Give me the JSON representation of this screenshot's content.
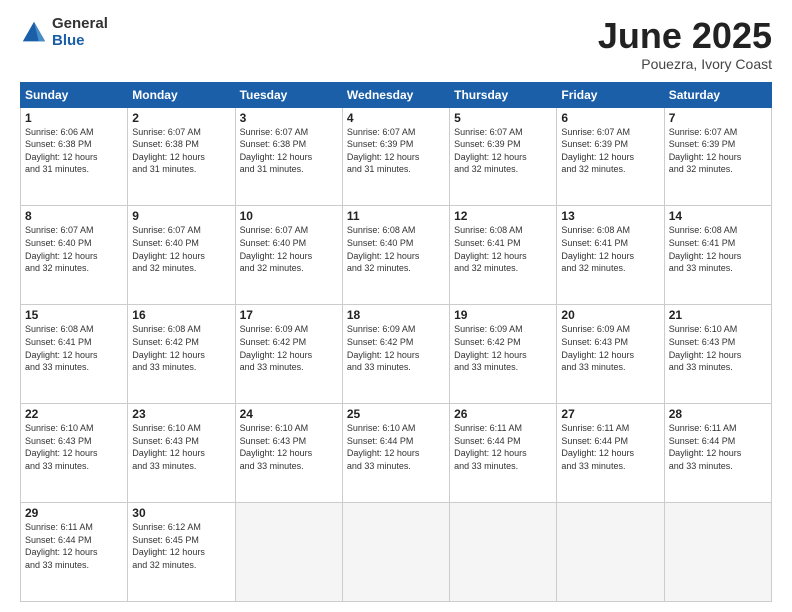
{
  "logo": {
    "general": "General",
    "blue": "Blue"
  },
  "title": {
    "month": "June 2025",
    "location": "Pouezra, Ivory Coast"
  },
  "weekdays": [
    "Sunday",
    "Monday",
    "Tuesday",
    "Wednesday",
    "Thursday",
    "Friday",
    "Saturday"
  ],
  "weeks": [
    [
      {
        "day": "1",
        "info": "Sunrise: 6:06 AM\nSunset: 6:38 PM\nDaylight: 12 hours\nand 31 minutes."
      },
      {
        "day": "2",
        "info": "Sunrise: 6:07 AM\nSunset: 6:38 PM\nDaylight: 12 hours\nand 31 minutes."
      },
      {
        "day": "3",
        "info": "Sunrise: 6:07 AM\nSunset: 6:38 PM\nDaylight: 12 hours\nand 31 minutes."
      },
      {
        "day": "4",
        "info": "Sunrise: 6:07 AM\nSunset: 6:39 PM\nDaylight: 12 hours\nand 31 minutes."
      },
      {
        "day": "5",
        "info": "Sunrise: 6:07 AM\nSunset: 6:39 PM\nDaylight: 12 hours\nand 32 minutes."
      },
      {
        "day": "6",
        "info": "Sunrise: 6:07 AM\nSunset: 6:39 PM\nDaylight: 12 hours\nand 32 minutes."
      },
      {
        "day": "7",
        "info": "Sunrise: 6:07 AM\nSunset: 6:39 PM\nDaylight: 12 hours\nand 32 minutes."
      }
    ],
    [
      {
        "day": "8",
        "info": "Sunrise: 6:07 AM\nSunset: 6:40 PM\nDaylight: 12 hours\nand 32 minutes."
      },
      {
        "day": "9",
        "info": "Sunrise: 6:07 AM\nSunset: 6:40 PM\nDaylight: 12 hours\nand 32 minutes."
      },
      {
        "day": "10",
        "info": "Sunrise: 6:07 AM\nSunset: 6:40 PM\nDaylight: 12 hours\nand 32 minutes."
      },
      {
        "day": "11",
        "info": "Sunrise: 6:08 AM\nSunset: 6:40 PM\nDaylight: 12 hours\nand 32 minutes."
      },
      {
        "day": "12",
        "info": "Sunrise: 6:08 AM\nSunset: 6:41 PM\nDaylight: 12 hours\nand 32 minutes."
      },
      {
        "day": "13",
        "info": "Sunrise: 6:08 AM\nSunset: 6:41 PM\nDaylight: 12 hours\nand 32 minutes."
      },
      {
        "day": "14",
        "info": "Sunrise: 6:08 AM\nSunset: 6:41 PM\nDaylight: 12 hours\nand 33 minutes."
      }
    ],
    [
      {
        "day": "15",
        "info": "Sunrise: 6:08 AM\nSunset: 6:41 PM\nDaylight: 12 hours\nand 33 minutes."
      },
      {
        "day": "16",
        "info": "Sunrise: 6:08 AM\nSunset: 6:42 PM\nDaylight: 12 hours\nand 33 minutes."
      },
      {
        "day": "17",
        "info": "Sunrise: 6:09 AM\nSunset: 6:42 PM\nDaylight: 12 hours\nand 33 minutes."
      },
      {
        "day": "18",
        "info": "Sunrise: 6:09 AM\nSunset: 6:42 PM\nDaylight: 12 hours\nand 33 minutes."
      },
      {
        "day": "19",
        "info": "Sunrise: 6:09 AM\nSunset: 6:42 PM\nDaylight: 12 hours\nand 33 minutes."
      },
      {
        "day": "20",
        "info": "Sunrise: 6:09 AM\nSunset: 6:43 PM\nDaylight: 12 hours\nand 33 minutes."
      },
      {
        "day": "21",
        "info": "Sunrise: 6:10 AM\nSunset: 6:43 PM\nDaylight: 12 hours\nand 33 minutes."
      }
    ],
    [
      {
        "day": "22",
        "info": "Sunrise: 6:10 AM\nSunset: 6:43 PM\nDaylight: 12 hours\nand 33 minutes."
      },
      {
        "day": "23",
        "info": "Sunrise: 6:10 AM\nSunset: 6:43 PM\nDaylight: 12 hours\nand 33 minutes."
      },
      {
        "day": "24",
        "info": "Sunrise: 6:10 AM\nSunset: 6:43 PM\nDaylight: 12 hours\nand 33 minutes."
      },
      {
        "day": "25",
        "info": "Sunrise: 6:10 AM\nSunset: 6:44 PM\nDaylight: 12 hours\nand 33 minutes."
      },
      {
        "day": "26",
        "info": "Sunrise: 6:11 AM\nSunset: 6:44 PM\nDaylight: 12 hours\nand 33 minutes."
      },
      {
        "day": "27",
        "info": "Sunrise: 6:11 AM\nSunset: 6:44 PM\nDaylight: 12 hours\nand 33 minutes."
      },
      {
        "day": "28",
        "info": "Sunrise: 6:11 AM\nSunset: 6:44 PM\nDaylight: 12 hours\nand 33 minutes."
      }
    ],
    [
      {
        "day": "29",
        "info": "Sunrise: 6:11 AM\nSunset: 6:44 PM\nDaylight: 12 hours\nand 33 minutes."
      },
      {
        "day": "30",
        "info": "Sunrise: 6:12 AM\nSunset: 6:45 PM\nDaylight: 12 hours\nand 32 minutes."
      },
      {
        "day": "",
        "info": ""
      },
      {
        "day": "",
        "info": ""
      },
      {
        "day": "",
        "info": ""
      },
      {
        "day": "",
        "info": ""
      },
      {
        "day": "",
        "info": ""
      }
    ]
  ]
}
